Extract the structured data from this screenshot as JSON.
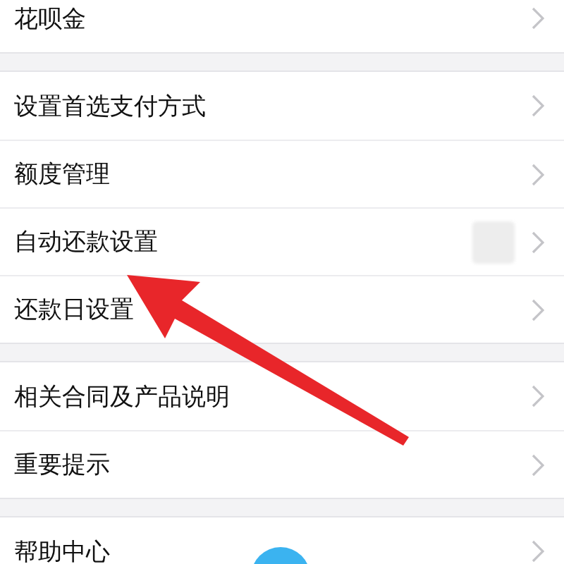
{
  "sections": [
    {
      "rows": [
        {
          "label": "花呗金",
          "blurred_value": false
        }
      ]
    },
    {
      "rows": [
        {
          "label": "设置首选支付方式",
          "blurred_value": false
        },
        {
          "label": "额度管理",
          "blurred_value": false
        },
        {
          "label": "自动还款设置",
          "blurred_value": true
        },
        {
          "label": "还款日设置",
          "blurred_value": false
        }
      ]
    },
    {
      "rows": [
        {
          "label": "相关合同及产品说明",
          "blurred_value": false
        },
        {
          "label": "重要提示",
          "blurred_value": false
        }
      ]
    },
    {
      "rows": [
        {
          "label": "帮助中心",
          "blurred_value": false
        }
      ]
    }
  ]
}
